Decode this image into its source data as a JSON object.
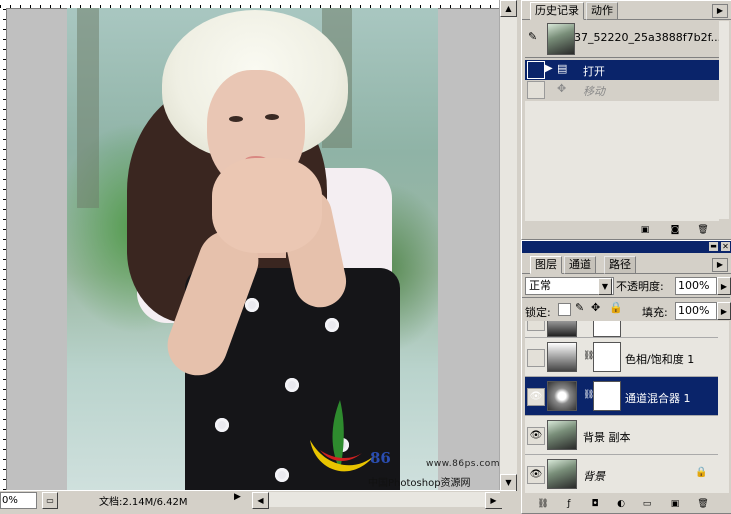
{
  "document": {
    "zoom": "0%",
    "status": "文档:2.14M/6.42M",
    "watermark": {
      "url": "www.86ps.com",
      "brand": "86",
      "site": "中国Photoshop资源网"
    }
  },
  "history_panel": {
    "tabs": [
      "历史记录",
      "动作"
    ],
    "snapshot_name": "37_52220_25a3888f7b2f...",
    "items": [
      "打开",
      "移动"
    ],
    "selected_index": 0
  },
  "layers_panel": {
    "tabs": [
      "图层",
      "通道",
      "路径"
    ],
    "blend_mode": "正常",
    "opacity_label": "不透明度:",
    "opacity_value": "100%",
    "lock_label": "锁定:",
    "fill_label": "填充:",
    "fill_value": "100%",
    "layers": [
      {
        "name": "",
        "visible": false,
        "type": "adjustment"
      },
      {
        "name": "色相/饱和度 1",
        "visible": false,
        "type": "adjustment"
      },
      {
        "name": "通道混合器 1",
        "visible": true,
        "type": "adjustment",
        "selected": true
      },
      {
        "name": "背景 副本",
        "visible": true,
        "type": "image"
      },
      {
        "name": "背景",
        "visible": true,
        "type": "image",
        "locked": true
      }
    ]
  },
  "colors": {
    "selection": "#0a246a",
    "panel_bg": "#d4d0c8"
  }
}
